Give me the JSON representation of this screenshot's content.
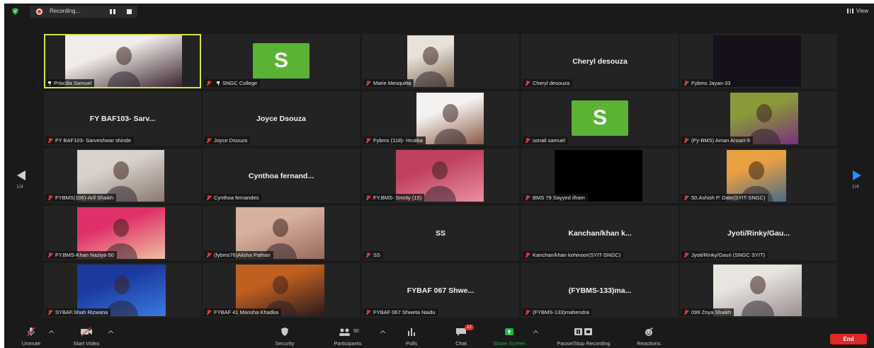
{
  "meeting": {
    "recording_status": "Recording...",
    "view_label": "View",
    "page_indicator_left": "1/4",
    "page_indicator_right": "1/4"
  },
  "tiles": [
    {
      "name": "Priscilla Samuel",
      "display": "video",
      "pinned": true,
      "muted": false,
      "active_speaker": true,
      "photo_colors": [
        "#f1ece7",
        "#3a2430"
      ]
    },
    {
      "name": "SNGC College",
      "display": "avatar",
      "avatar_letter": "S",
      "avatar_color": "#5bb234",
      "pinned": true,
      "muted": true
    },
    {
      "name": "Marie Mesquitta",
      "display": "video",
      "muted": true,
      "photo_colors": [
        "#e9e2da",
        "#7a6550"
      ]
    },
    {
      "name": "Cheryl desouza",
      "display": "name",
      "big_label": "Cheryl desouza",
      "muted": true
    },
    {
      "name": "Fybms Jayan-33",
      "display": "dark",
      "muted": true
    },
    {
      "name": "FY BAF103- Sarveshwar shinde",
      "display": "name",
      "big_label": "FY BAF103- Sarv...",
      "muted": true
    },
    {
      "name": "Joyce Dsouza",
      "display": "name",
      "big_label": "Joyce Dsouza",
      "muted": true
    },
    {
      "name": "Fybms (118)- Hrutika",
      "display": "video",
      "muted": true,
      "photo_colors": [
        "#f4f2f0",
        "#8a5a45"
      ]
    },
    {
      "name": "sonali samuel",
      "display": "avatar",
      "avatar_letter": "S",
      "avatar_color": "#5bb234",
      "muted": true
    },
    {
      "name": "(Fy-BMS) Aman Ansari-9",
      "display": "video",
      "muted": true,
      "photo_colors": [
        "#8a9a3a",
        "#7a2f7a"
      ]
    },
    {
      "name": "FYBMS(106)-Arif Shaikh",
      "display": "video",
      "muted": true,
      "photo_colors": [
        "#d9d2cc",
        "#8a7a70"
      ]
    },
    {
      "name": "Cynthoa fernandes",
      "display": "name",
      "big_label": "Cynthoa fernand...",
      "muted": true
    },
    {
      "name": "FY.BMS- Smrity (15)",
      "display": "video",
      "muted": true,
      "photo_colors": [
        "#c04060",
        "#e890a0"
      ]
    },
    {
      "name": "BMS 79 Sayyed ilham",
      "display": "dark",
      "muted": true
    },
    {
      "name": "50.Ashish P. Date(SYIT-SNGC)",
      "display": "video",
      "muted": true,
      "photo_colors": [
        "#e8a040",
        "#4a6a8a"
      ]
    },
    {
      "name": "FY.BMS-Khan Naziya-50",
      "display": "video",
      "muted": true,
      "photo_colors": [
        "#e0306a",
        "#f0c0a0"
      ]
    },
    {
      "name": "(fybms76)Alisha Pathan",
      "display": "video",
      "muted": true,
      "photo_colors": [
        "#d8b0a0",
        "#9a6a5a"
      ]
    },
    {
      "name": "SS",
      "display": "name",
      "big_label": "SS",
      "muted": true
    },
    {
      "name": "Kanchan/khan kohinoor(SYIT-SNGC)",
      "display": "name",
      "big_label": "Kanchan/khan k...",
      "muted": true
    },
    {
      "name": "Jyoti/Rinky/Gauri (SNGC SYIT)",
      "display": "name",
      "big_label": "Jyoti/Rinky/Gau...",
      "muted": true
    },
    {
      "name": "SYBAF.Shah Rizwana",
      "display": "video",
      "muted": true,
      "photo_colors": [
        "#1a3aa0",
        "#3a7ae0"
      ]
    },
    {
      "name": "FYBAF 41 Mansha Khadka",
      "display": "video",
      "muted": true,
      "photo_colors": [
        "#c06020",
        "#2a1a1a"
      ]
    },
    {
      "name": "FYBAF 067 Shweta Naidu",
      "display": "name",
      "big_label": "FYBAF 067 Shwe...",
      "muted": true
    },
    {
      "name": "(FYBMS-133)mahendra",
      "display": "name",
      "big_label": "(FYBMS-133)ma...",
      "muted": true
    },
    {
      "name": "099 Zoya Shaikh",
      "display": "video",
      "muted": true,
      "photo_colors": [
        "#e8e4e0",
        "#9a9090"
      ]
    }
  ],
  "toolbar": {
    "unmute": "Unmute",
    "start_video": "Start Video",
    "security": "Security",
    "participants": "Participants",
    "participant_count": "90",
    "polls": "Polls",
    "chat": "Chat",
    "chat_badge": "12",
    "share_screen": "Share Screen",
    "pause_stop_recording": "Pause/Stop Recording",
    "reactions": "Reactions",
    "end": "End"
  },
  "colors": {
    "background": "#1a1a1a",
    "tile": "#232323",
    "active_border": "#d6e34a",
    "share_green": "#22b34a",
    "end_red": "#e02828",
    "next_arrow_blue": "#2d8cff"
  }
}
